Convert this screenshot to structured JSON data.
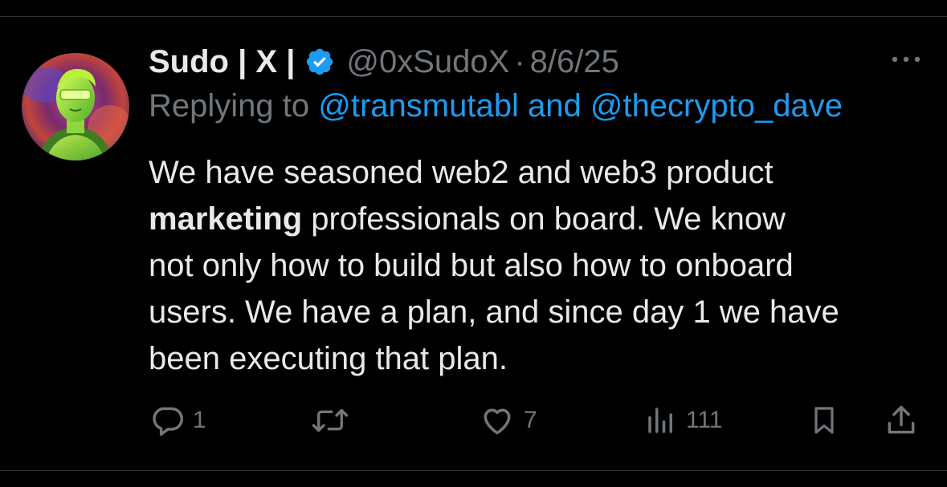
{
  "tweet": {
    "display_name": "Sudo | X |",
    "handle": "@0xSudoX",
    "separator": "·",
    "date": "8/6/25",
    "replying_prefix": "Replying to",
    "mention_1": "@transmutabl",
    "mention_joiner": "and",
    "mention_2": "@thecrypto_dave",
    "body": {
      "line1": "We have seasoned web2 and web3 product",
      "line2_bold": "marketing",
      "line2_rest": " professionals on board. We know",
      "line3": "not only how to build but also how to onboard",
      "line4": "users. We have a plan, and since day 1 we have",
      "line5": "been executing that plan."
    }
  },
  "actions": {
    "replies": "1",
    "reposts": "",
    "likes": "7",
    "views": "111"
  },
  "icons": {
    "verified": "verified-badge-icon",
    "more": "more-options-icon",
    "reply": "reply-bubble-icon",
    "repost": "repost-arrows-icon",
    "like": "heart-icon",
    "views": "bar-chart-icon",
    "bookmark": "bookmark-icon",
    "share": "share-upload-icon"
  },
  "colors": {
    "background": "#000000",
    "text": "#e7e9ea",
    "muted": "#71767b",
    "accent": "#1d9bf0",
    "divider": "#2f3336"
  }
}
